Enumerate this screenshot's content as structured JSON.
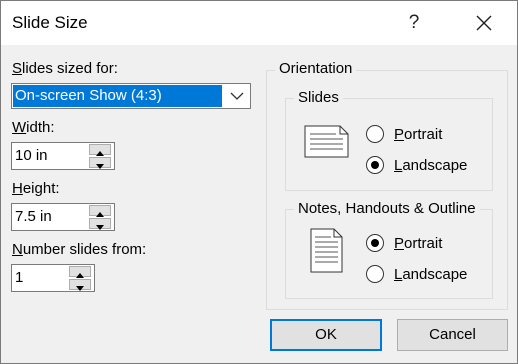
{
  "window": {
    "title": "Slide Size",
    "help_glyph": "?"
  },
  "slides_sized_for": {
    "label_hotkey": "S",
    "label_rest": "lides sized for:",
    "value": "On-screen Show (4:3)"
  },
  "width": {
    "label_hotkey": "W",
    "label_rest": "idth:",
    "value": "10 in"
  },
  "height": {
    "label_hotkey": "H",
    "label_rest": "eight:",
    "value": "7.5 in"
  },
  "number_slides_from": {
    "label_hotkey": "N",
    "label_rest": "umber slides from:",
    "value": "1"
  },
  "orientation": {
    "title": "Orientation",
    "slides": {
      "title": "Slides",
      "portrait_hotkey": "P",
      "portrait_rest": "ortrait",
      "landscape_hotkey": "L",
      "landscape_rest": "andscape",
      "selected": "landscape"
    },
    "notes": {
      "title": "Notes, Handouts & Outline",
      "portrait_hotkey": "P",
      "portrait_rest": "ortrait",
      "landscape_hotkey": "L",
      "landscape_rest": "andscape",
      "selected": "portrait"
    }
  },
  "buttons": {
    "ok": "OK",
    "cancel": "Cancel"
  },
  "colors": {
    "selection": "#0078d7",
    "dialog_bg": "#f0f0f0"
  }
}
